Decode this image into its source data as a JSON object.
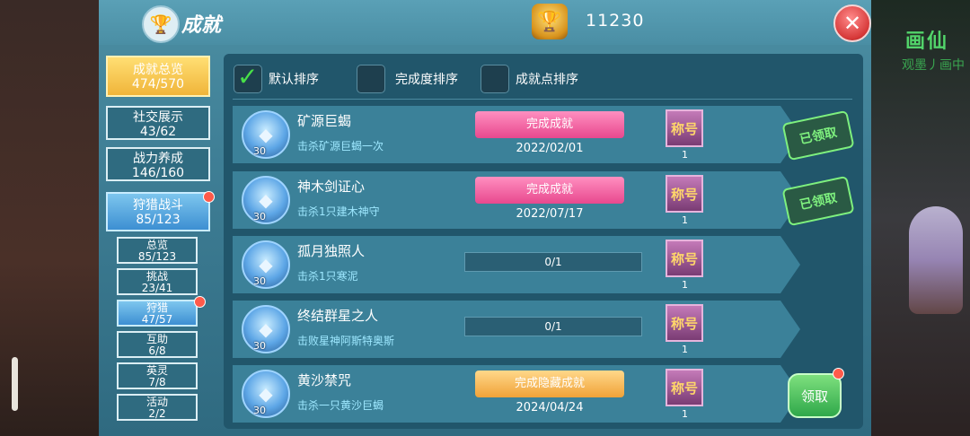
{
  "header": {
    "title": "成就",
    "points": "11230",
    "close_icon": "close-icon"
  },
  "background": {
    "player_name": "画仙",
    "player_subtitle": "观墨丿画中"
  },
  "sidebar": {
    "categories": [
      {
        "label": "成就总览",
        "count": "474/570"
      },
      {
        "label": "社交展示",
        "count": "43/62"
      },
      {
        "label": "战力养成",
        "count": "146/160"
      },
      {
        "label": "狩猎战斗",
        "count": "85/123"
      }
    ],
    "subcategories": [
      {
        "label": "总览",
        "count": "85/123"
      },
      {
        "label": "挑战",
        "count": "23/41"
      },
      {
        "label": "狩猎",
        "count": "47/57"
      },
      {
        "label": "互助",
        "count": "6/8"
      },
      {
        "label": "英灵",
        "count": "7/8"
      },
      {
        "label": "活动",
        "count": "2/2"
      }
    ]
  },
  "sort": {
    "options": [
      {
        "label": "默认排序",
        "checked": true
      },
      {
        "label": "完成度排序",
        "checked": false
      },
      {
        "label": "成就点排序",
        "checked": false
      }
    ]
  },
  "achievements": [
    {
      "name": "矿源巨蝎",
      "desc": "击杀矿源巨蝎一次",
      "points": "30",
      "status": "完成成就",
      "date": "2022/02/01",
      "reward": "称号",
      "reward_count": "1",
      "claim": "已领取"
    },
    {
      "name": "神木剑证心",
      "desc": "击杀1只建木神守",
      "points": "30",
      "status": "完成成就",
      "date": "2022/07/17",
      "reward": "称号",
      "reward_count": "1",
      "claim": "已领取"
    },
    {
      "name": "孤月独照人",
      "desc": "击杀1只寒泥",
      "points": "30",
      "progress": "0/1",
      "reward": "称号",
      "reward_count": "1"
    },
    {
      "name": "终结群星之人",
      "desc": "击败星神阿斯特奥斯",
      "points": "30",
      "progress": "0/1",
      "reward": "称号",
      "reward_count": "1"
    },
    {
      "name": "黄沙禁咒",
      "desc": "击杀一只黄沙巨蝎",
      "points": "30",
      "status": "完成隐藏成就",
      "date": "2024/04/24",
      "reward": "称号",
      "reward_count": "1",
      "claim": "领取"
    }
  ],
  "colors": {
    "panel": "#3f7f96",
    "accent_green": "#48e048",
    "ribbon_pink": "#e8488e",
    "ribbon_gold": "#f0a238"
  }
}
